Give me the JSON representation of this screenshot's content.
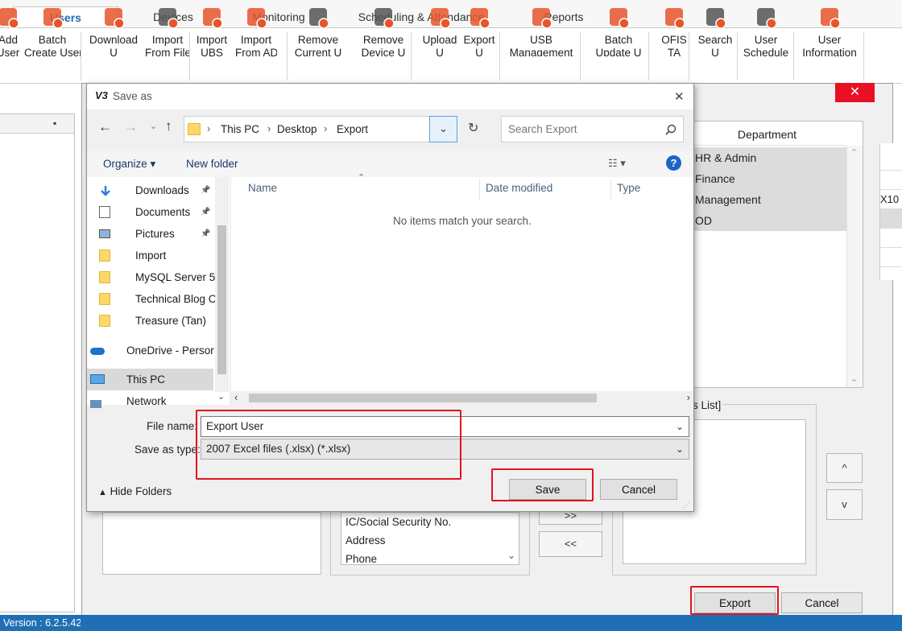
{
  "tabs": [
    "Users",
    "Devices",
    "Monitoring",
    "Scheduling & Attendance",
    "Reports"
  ],
  "ribbon": {
    "buttons": [
      {
        "label": "Add\nUser",
        "icon": "add-user-icon"
      },
      {
        "label": "Batch\nCreate User",
        "icon": "batch-create-user-icon"
      },
      {
        "label": "Download\nU",
        "icon": "download-icon"
      },
      {
        "label": "Import\nFrom File",
        "icon": "folder-open-icon"
      },
      {
        "label": "Import\nUBS",
        "icon": "ubs-icon"
      },
      {
        "label": "Import\nFrom AD",
        "icon": "ad-icon"
      },
      {
        "label": "Remove\nCurrent U",
        "icon": "remove-user-icon"
      },
      {
        "label": "Remove\nDevice U",
        "icon": "remove-device-icon"
      },
      {
        "label": "Upload\nU",
        "icon": "upload-icon"
      },
      {
        "label": "Export\nU",
        "icon": "export-icon"
      },
      {
        "label": "USB\nManagement",
        "icon": "usb-icon"
      },
      {
        "label": "Batch\nUpdate U",
        "icon": "batch-update-icon"
      },
      {
        "label": "OFIS\nTA",
        "icon": "ofis-icon"
      },
      {
        "label": "Search\nU",
        "icon": "search-user-icon"
      },
      {
        "label": "User\nSchedule",
        "icon": "user-schedule-icon"
      },
      {
        "label": "User\nInformation",
        "icon": "user-info-icon"
      }
    ]
  },
  "background": {
    "pin_glyph": "▪",
    "department_header": "Department",
    "departments": [
      "HR & Admin",
      "Finance",
      "Management",
      "OD"
    ],
    "right_partial_text": "X10",
    "list_caption": "s List]",
    "fields_list": [
      "IC/Social Security No.",
      "Address",
      "Phone"
    ],
    "move_right": ">>",
    "move_left": "<<",
    "up_label": "^",
    "down_label": "v",
    "export_label": "Export",
    "cancel_label": "Cancel",
    "close_x": "✕",
    "version": "Version : 6.2.5.42"
  },
  "dialog": {
    "title": "Save as",
    "app_badge": "V3",
    "close": "✕",
    "breadcrumb": [
      "This PC",
      "Desktop",
      "Export"
    ],
    "search_placeholder": "Search Export",
    "organize": "Organize",
    "new_folder": "New folder",
    "help": "?",
    "columns": {
      "name": "Name",
      "date": "Date modified",
      "type": "Type"
    },
    "empty_message": "No items match your search.",
    "nav_items": [
      {
        "label": "Downloads",
        "pinned": true
      },
      {
        "label": "Documents",
        "pinned": true
      },
      {
        "label": "Pictures",
        "pinned": true
      },
      {
        "label": "Import",
        "pinned": false
      },
      {
        "label": "MySQL Server 5.",
        "pinned": false
      },
      {
        "label": "Technical Blog C",
        "pinned": false
      },
      {
        "label": "Treasure (Tan)",
        "pinned": false
      },
      {
        "label": "OneDrive - Persor",
        "pinned": false
      },
      {
        "label": "This PC",
        "pinned": false,
        "selected": true
      },
      {
        "label": "Network",
        "pinned": false
      }
    ],
    "file_name_label": "File name:",
    "file_name_value": "Export User",
    "save_type_label": "Save as type:",
    "save_type_value": "2007 Excel files (.xlsx) (*.xlsx)",
    "hide_folders": "Hide Folders",
    "save_button": "Save",
    "cancel_button": "Cancel"
  },
  "colors": {
    "accent": "#1f6fb4",
    "highlight_red": "#e0141e",
    "close_red": "#e81123",
    "status_bar": "#1f6fb4"
  }
}
